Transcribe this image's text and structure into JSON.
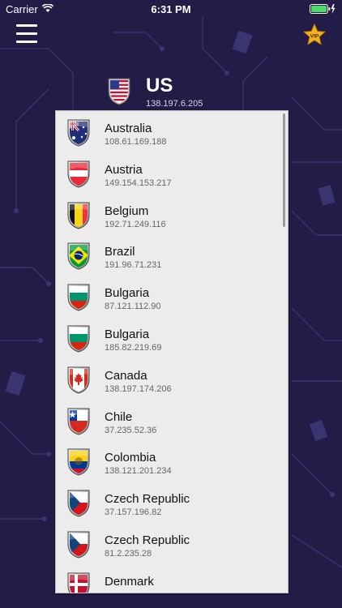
{
  "status_bar": {
    "carrier": "Carrier",
    "time": "6:31 PM"
  },
  "colors": {
    "background": "#221c47",
    "list_background": "#ececec",
    "vip_star": "#f2b31c"
  },
  "toolbar": {
    "menu_icon": "hamburger-menu-icon",
    "vip_icon": "vip-star-icon",
    "vip_label": "VIP"
  },
  "current_server": {
    "country": "US",
    "ip": "138.197.6.205",
    "flag": "us"
  },
  "servers": [
    {
      "country": "Australia",
      "ip": "108.61.169.188",
      "flag": "australia"
    },
    {
      "country": "Austria",
      "ip": "149.154.153.217",
      "flag": "austria"
    },
    {
      "country": "Belgium",
      "ip": "192.71.249.116",
      "flag": "belgium"
    },
    {
      "country": "Brazil",
      "ip": "191.96.71.231",
      "flag": "brazil"
    },
    {
      "country": "Bulgaria",
      "ip": "87.121.112.90",
      "flag": "bulgaria"
    },
    {
      "country": "Bulgaria",
      "ip": "185.82.219.69",
      "flag": "bulgaria"
    },
    {
      "country": "Canada",
      "ip": "138.197.174.206",
      "flag": "canada"
    },
    {
      "country": "Chile",
      "ip": "37.235.52.36",
      "flag": "chile"
    },
    {
      "country": "Colombia",
      "ip": "138.121.201.234",
      "flag": "colombia"
    },
    {
      "country": "Czech Republic",
      "ip": "37.157.196.82",
      "flag": "czech"
    },
    {
      "country": "Czech Republic",
      "ip": "81.2.235.28",
      "flag": "czech"
    },
    {
      "country": "Denmark",
      "ip": "",
      "flag": "denmark"
    }
  ]
}
